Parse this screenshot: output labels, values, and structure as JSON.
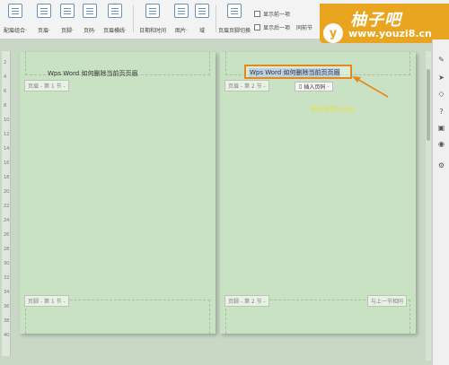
{
  "ribbon": {
    "buttons": [
      {
        "id": "header-footer-options",
        "label": "配眉组合·"
      },
      {
        "id": "header",
        "label": "页眉·"
      },
      {
        "id": "footer",
        "label": "页脚·"
      },
      {
        "id": "page-number",
        "label": "页码·"
      },
      {
        "id": "header-spacing",
        "label": "页眉横线·"
      },
      {
        "id": "date-time",
        "label": "日期和时间"
      },
      {
        "id": "picture",
        "label": "图片·"
      },
      {
        "id": "field",
        "label": "域"
      },
      {
        "id": "switch-header-footer",
        "label": "页眉页脚切换"
      }
    ],
    "show_prev": "显示前一项",
    "show_next": "显示后一项",
    "same_as_prev": "同前节"
  },
  "watermark": {
    "badge": "y",
    "brand": "柚子吧",
    "url": "www.youzi8.cn"
  },
  "ruler_marks": [
    "2",
    "4",
    "6",
    "8",
    "10",
    "12",
    "14",
    "16",
    "18",
    "20",
    "22",
    "24",
    "26",
    "28",
    "30",
    "32",
    "34",
    "36",
    "38",
    "40"
  ],
  "page1": {
    "header_text": "Wps Word 如何删除当前页页眉",
    "header_tag": "页眉 - 第 1 节 -",
    "footer_tag": "页脚 - 第 1 节 -"
  },
  "page2": {
    "header_text": "Wps Word 如何删除当前页页眉",
    "header_tag": "页眉 - 第 2 节 -",
    "footer_tag": "页脚 - 第 2 节 -",
    "same_as_prev_tag": "与上一节相同",
    "insert_page_number": "插入页码 ·",
    "annotation": "删除需要的页眉"
  },
  "colors": {
    "page_bg": "#c8e2c3",
    "highlight": "#e58a1a",
    "logo_bg": "#e9a520"
  },
  "sidebar_icons": [
    "pencil-icon",
    "cursor-icon",
    "shape-icon",
    "help-icon",
    "lock-icon",
    "location-icon",
    "wrench-icon"
  ]
}
